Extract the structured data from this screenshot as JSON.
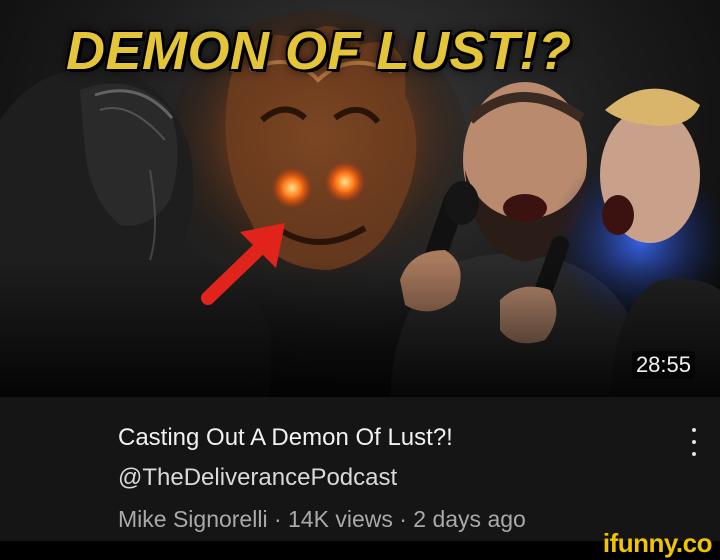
{
  "thumbnail": {
    "overlay_title": "DEMON OF LUST!?",
    "duration": "28:55"
  },
  "video": {
    "title": "Casting Out A Demon Of Lust?!",
    "channel": "@TheDeliverancePodcast",
    "author": "Mike Signorelli",
    "views": "14K views",
    "age": "2 days ago",
    "separator": " · "
  },
  "menu": {
    "icon": "more-vertical-icon"
  },
  "watermark": {
    "text": "ifunny.co"
  },
  "colors": {
    "title_yellow": "#e4c53a",
    "arrow_red": "#e0241b",
    "demon_eyes": "#ff7a1a",
    "watermark_yellow": "#f0c400",
    "meta_bg": "#151515"
  }
}
